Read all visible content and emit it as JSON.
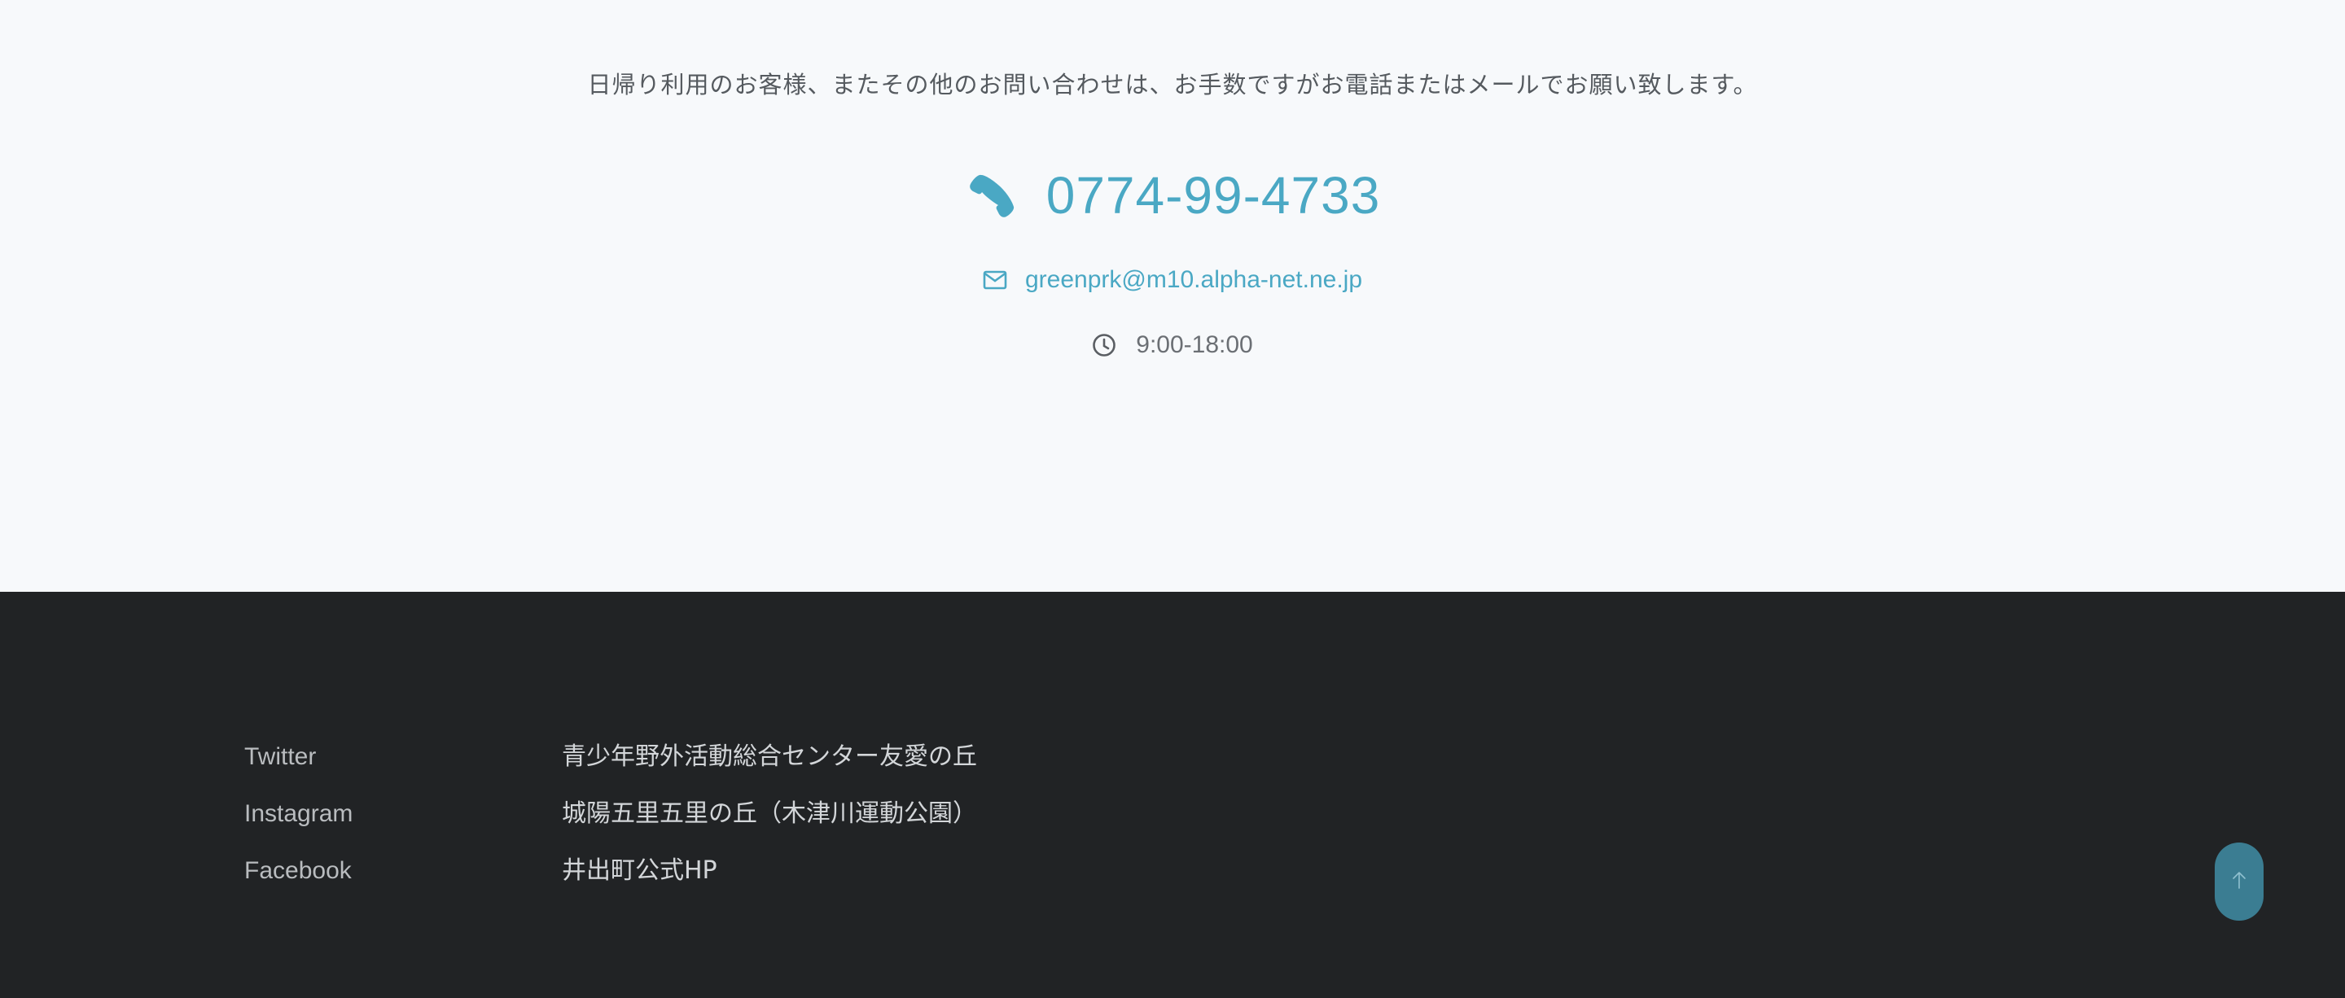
{
  "contact": {
    "notice": "日帰り利用のお客様、またその他のお問い合わせは、お手数ですがお電話またはメールでお願い致します。",
    "phone": "0774-99-4733",
    "email": "greenprk@m10.alpha-net.ne.jp",
    "hours": "9:00-18:00",
    "accent_color": "#4aa8c4"
  },
  "footer": {
    "social_links": [
      {
        "label": "Twitter"
      },
      {
        "label": "Instagram"
      },
      {
        "label": "Facebook"
      }
    ],
    "related_links": [
      {
        "label": "青少年野外活動総合センター友愛の丘"
      },
      {
        "label": "城陽五里五里の丘（木津川運動公園）"
      },
      {
        "label": "井出町公式HP"
      }
    ],
    "background_color": "#212325"
  },
  "back_to_top": {
    "icon": "arrow-up-icon",
    "color": "#3b7d92"
  }
}
